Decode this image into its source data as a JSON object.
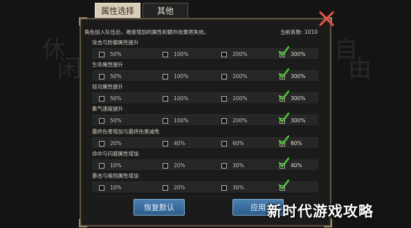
{
  "background_deco": {
    "left": [
      "休",
      "闲"
    ],
    "right": [
      "自",
      "由"
    ]
  },
  "tabs": [
    {
      "label": "属性选择",
      "active": true
    },
    {
      "label": "其他",
      "active": false
    }
  ],
  "note": "角色加入队伍后，难度增加的属性和额外效果将失效。",
  "coefficient": {
    "label": "当前系数:",
    "value": "1010"
  },
  "sections": [
    {
      "title": "攻击与防御属性提升",
      "options": [
        {
          "label": "50%",
          "checked": false
        },
        {
          "label": "100%",
          "checked": false
        },
        {
          "label": "200%",
          "checked": false
        },
        {
          "label": "300%",
          "checked": true
        }
      ]
    },
    {
      "title": "生命属性提升",
      "options": [
        {
          "label": "50%",
          "checked": false
        },
        {
          "label": "100%",
          "checked": false
        },
        {
          "label": "200%",
          "checked": false
        },
        {
          "label": "300%",
          "checked": true
        }
      ]
    },
    {
      "title": "轻功属性提升",
      "options": [
        {
          "label": "50%",
          "checked": false
        },
        {
          "label": "100%",
          "checked": false
        },
        {
          "label": "200%",
          "checked": false
        },
        {
          "label": "300%",
          "checked": true
        }
      ]
    },
    {
      "title": "集气速度提升",
      "options": [
        {
          "label": "50%",
          "checked": false
        },
        {
          "label": "100%",
          "checked": false
        },
        {
          "label": "200%",
          "checked": false
        },
        {
          "label": "300%",
          "checked": true
        }
      ]
    },
    {
      "title": "最终伤害增加与最终伤害减免",
      "options": [
        {
          "label": "20%",
          "checked": false
        },
        {
          "label": "40%",
          "checked": false
        },
        {
          "label": "60%",
          "checked": false
        },
        {
          "label": "80%",
          "checked": true
        }
      ]
    },
    {
      "title": "命中与闪避属性增加",
      "options": [
        {
          "label": "10%",
          "checked": false
        },
        {
          "label": "20%",
          "checked": false
        },
        {
          "label": "30%",
          "checked": false
        },
        {
          "label": "40%",
          "checked": true
        }
      ]
    },
    {
      "title": "暴击与格挡属性增加",
      "options": [
        {
          "label": "10%",
          "checked": false
        },
        {
          "label": "20%",
          "checked": false
        },
        {
          "label": "30%",
          "checked": false
        },
        {
          "label": "",
          "checked": true
        }
      ]
    }
  ],
  "buttons": {
    "reset": "恢复默认",
    "apply": "应用"
  },
  "watermark": "新时代游戏攻略",
  "colors": {
    "accent_check": "#4fc23a",
    "close": "#c0392b",
    "frame": "#5e5243",
    "button": "#3a6fa0"
  },
  "icons": {
    "close": "close-icon",
    "check": "check-icon"
  }
}
